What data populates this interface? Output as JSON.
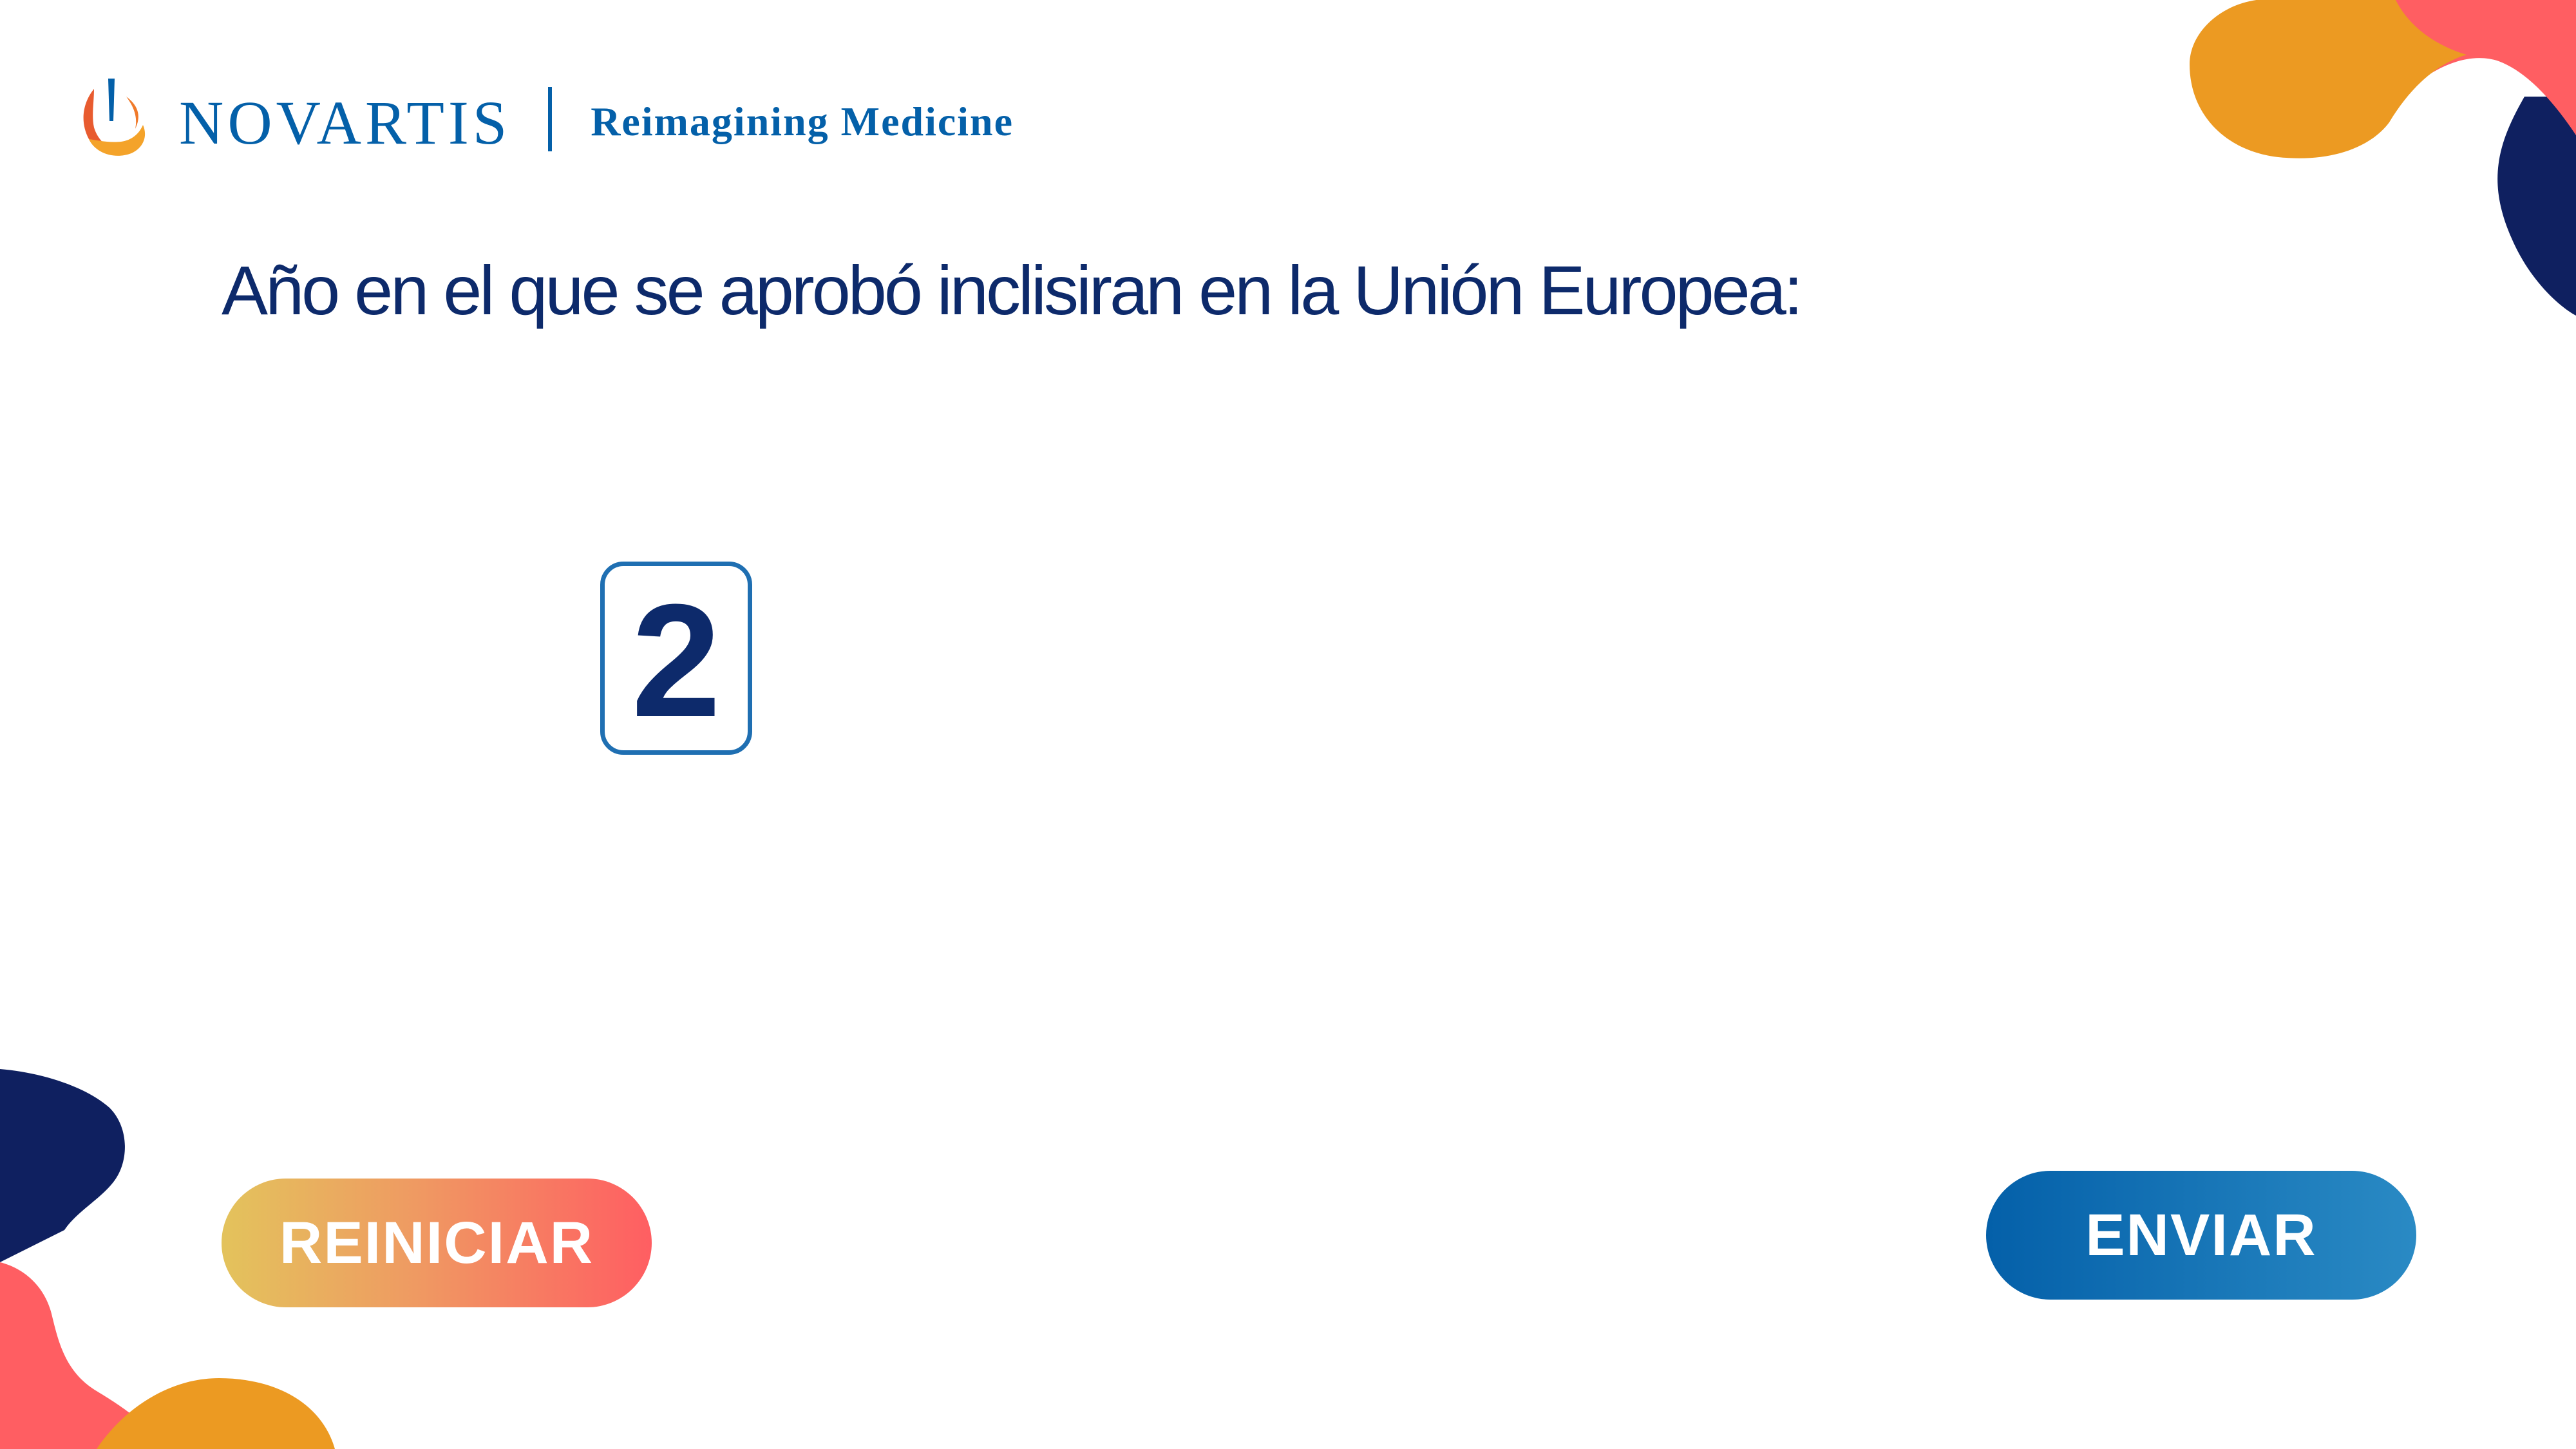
{
  "brand": {
    "name": "NOVARTIS",
    "tagline": "Reimagining Medicine"
  },
  "question": {
    "text": "Año en el que se aprobó inclisiran en la Unión Europea:"
  },
  "answer": {
    "digits": [
      "2"
    ]
  },
  "buttons": {
    "reset_label": "REINICIAR",
    "send_label": "ENVIAR"
  },
  "colors": {
    "navy": "#0d2a6b",
    "brand_blue": "#0460a9",
    "orange": "#ec9a22",
    "coral": "#ff5e62",
    "dark_navy": "#0f2060"
  },
  "icons": {
    "logo": "novartis-flame-icon"
  }
}
